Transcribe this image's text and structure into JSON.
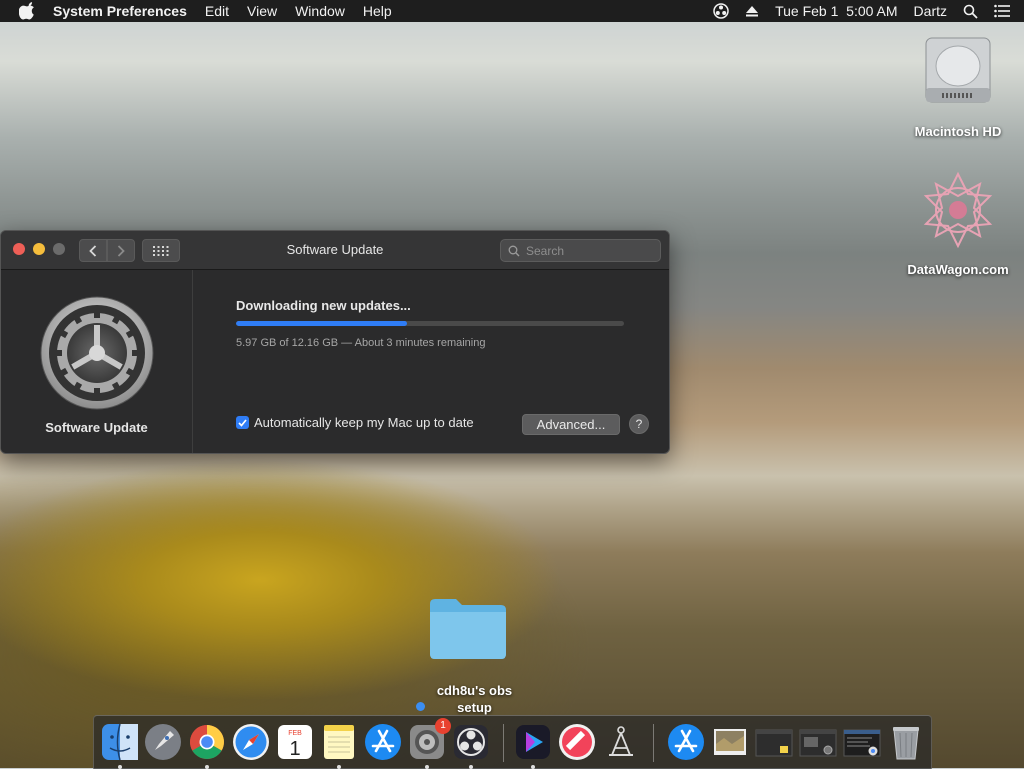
{
  "menubar": {
    "app_name": "System Preferences",
    "menus": [
      "Edit",
      "View",
      "Window",
      "Help"
    ],
    "clock": "Tue Feb 1  5:00 AM",
    "user": "Dartz"
  },
  "window": {
    "title": "Software Update",
    "search_placeholder": "Search",
    "sidebar_label": "Software Update",
    "status": "Downloading new updates...",
    "progress_fraction": 0.44,
    "detail": "5.97 GB of 12.16 GB — About 3 minutes remaining",
    "auto_update_label": "Automatically keep my Mac up to date",
    "auto_update_checked": true,
    "advanced_label": "Advanced...",
    "help_label": "?"
  },
  "desktop": {
    "items": [
      {
        "label": "Macintosh HD",
        "icon": "hard-drive-icon"
      },
      {
        "label": "DataWagon.com",
        "icon": "datawagon-logo-icon"
      },
      {
        "label": "cdh8u's obs setup",
        "icon": "folder-icon"
      }
    ]
  },
  "dock": {
    "calendar_month": "FEB",
    "calendar_day": "1",
    "sysprefs_badge": "1",
    "items": [
      "finder",
      "launchpad",
      "chrome",
      "safari",
      "calendar",
      "notes",
      "app-store",
      "system-preferences",
      "obs",
      "video-player",
      "news",
      "toolbox",
      "app-store-downloads",
      "preview",
      "window-1",
      "window-2",
      "window-3",
      "trash"
    ]
  },
  "colors": {
    "accent": "#2f7df6",
    "window_bg": "#2b2b2c",
    "menubar_bg": "#1e1e1e"
  }
}
